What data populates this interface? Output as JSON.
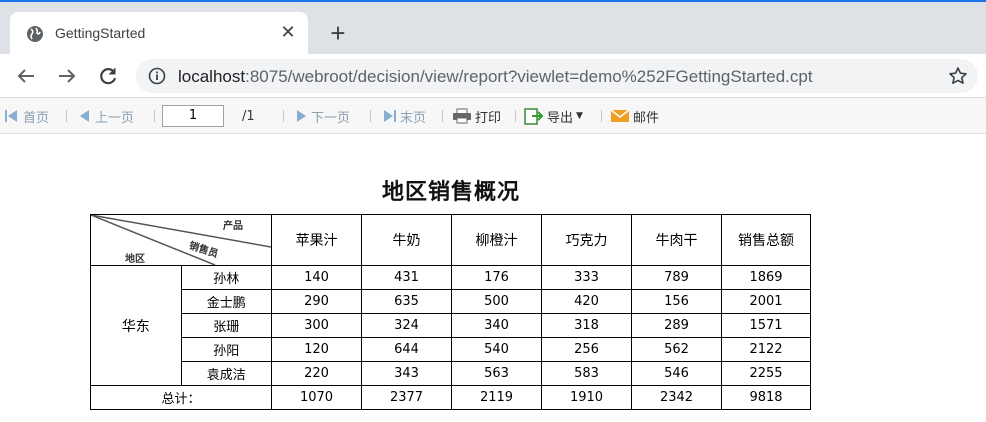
{
  "browser": {
    "tab_title": "GettingStarted",
    "url_host": "localhost",
    "url_rest": ":8075/webroot/decision/view/report?viewlet=demo%252FGettingStarted.cpt"
  },
  "toolbar": {
    "first": "首页",
    "prev": "上一页",
    "page_value": "1",
    "page_total": "/1",
    "next": "下一页",
    "last": "末页",
    "print": "打印",
    "export": "导出",
    "mail": "邮件"
  },
  "report": {
    "title": "地区销售概况",
    "corner": {
      "product": "产品",
      "salesperson": "销售员",
      "region": "地区"
    },
    "columns": [
      "苹果汁",
      "牛奶",
      "柳橙汁",
      "巧克力",
      "牛肉干",
      "销售总额"
    ],
    "region": "华东",
    "rows": [
      {
        "name": "孙林",
        "values": [
          "140",
          "431",
          "176",
          "333",
          "789",
          "1869"
        ]
      },
      {
        "name": "金士鹏",
        "values": [
          "290",
          "635",
          "500",
          "420",
          "156",
          "2001"
        ]
      },
      {
        "name": "张珊",
        "values": [
          "300",
          "324",
          "340",
          "318",
          "289",
          "1571"
        ]
      },
      {
        "name": "孙阳",
        "values": [
          "120",
          "644",
          "540",
          "256",
          "562",
          "2122"
        ]
      },
      {
        "name": "袁成洁",
        "values": [
          "220",
          "343",
          "563",
          "583",
          "546",
          "2255"
        ]
      }
    ],
    "total_label": "总计：",
    "totals": [
      "1070",
      "2377",
      "2119",
      "1910",
      "2342",
      "9818"
    ]
  }
}
